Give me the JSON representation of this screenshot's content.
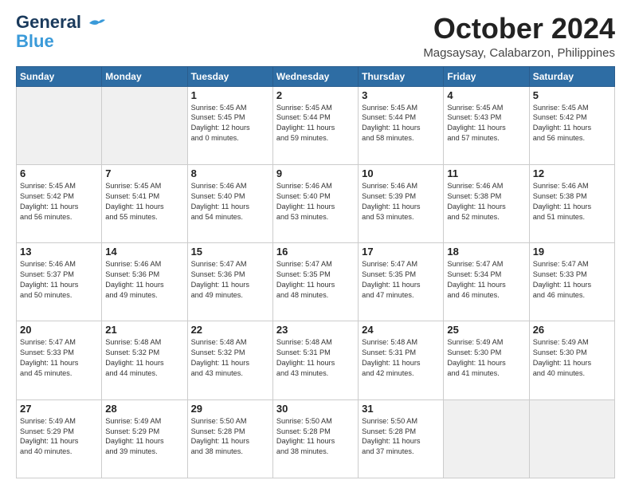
{
  "logo": {
    "line1": "General",
    "line2": "Blue"
  },
  "header": {
    "month": "October 2024",
    "location": "Magsaysay, Calabarzon, Philippines"
  },
  "weekdays": [
    "Sunday",
    "Monday",
    "Tuesday",
    "Wednesday",
    "Thursday",
    "Friday",
    "Saturday"
  ],
  "weeks": [
    [
      {
        "day": "",
        "info": ""
      },
      {
        "day": "",
        "info": ""
      },
      {
        "day": "1",
        "info": "Sunrise: 5:45 AM\nSunset: 5:45 PM\nDaylight: 12 hours\nand 0 minutes."
      },
      {
        "day": "2",
        "info": "Sunrise: 5:45 AM\nSunset: 5:44 PM\nDaylight: 11 hours\nand 59 minutes."
      },
      {
        "day": "3",
        "info": "Sunrise: 5:45 AM\nSunset: 5:44 PM\nDaylight: 11 hours\nand 58 minutes."
      },
      {
        "day": "4",
        "info": "Sunrise: 5:45 AM\nSunset: 5:43 PM\nDaylight: 11 hours\nand 57 minutes."
      },
      {
        "day": "5",
        "info": "Sunrise: 5:45 AM\nSunset: 5:42 PM\nDaylight: 11 hours\nand 56 minutes."
      }
    ],
    [
      {
        "day": "6",
        "info": "Sunrise: 5:45 AM\nSunset: 5:42 PM\nDaylight: 11 hours\nand 56 minutes."
      },
      {
        "day": "7",
        "info": "Sunrise: 5:45 AM\nSunset: 5:41 PM\nDaylight: 11 hours\nand 55 minutes."
      },
      {
        "day": "8",
        "info": "Sunrise: 5:46 AM\nSunset: 5:40 PM\nDaylight: 11 hours\nand 54 minutes."
      },
      {
        "day": "9",
        "info": "Sunrise: 5:46 AM\nSunset: 5:40 PM\nDaylight: 11 hours\nand 53 minutes."
      },
      {
        "day": "10",
        "info": "Sunrise: 5:46 AM\nSunset: 5:39 PM\nDaylight: 11 hours\nand 53 minutes."
      },
      {
        "day": "11",
        "info": "Sunrise: 5:46 AM\nSunset: 5:38 PM\nDaylight: 11 hours\nand 52 minutes."
      },
      {
        "day": "12",
        "info": "Sunrise: 5:46 AM\nSunset: 5:38 PM\nDaylight: 11 hours\nand 51 minutes."
      }
    ],
    [
      {
        "day": "13",
        "info": "Sunrise: 5:46 AM\nSunset: 5:37 PM\nDaylight: 11 hours\nand 50 minutes."
      },
      {
        "day": "14",
        "info": "Sunrise: 5:46 AM\nSunset: 5:36 PM\nDaylight: 11 hours\nand 49 minutes."
      },
      {
        "day": "15",
        "info": "Sunrise: 5:47 AM\nSunset: 5:36 PM\nDaylight: 11 hours\nand 49 minutes."
      },
      {
        "day": "16",
        "info": "Sunrise: 5:47 AM\nSunset: 5:35 PM\nDaylight: 11 hours\nand 48 minutes."
      },
      {
        "day": "17",
        "info": "Sunrise: 5:47 AM\nSunset: 5:35 PM\nDaylight: 11 hours\nand 47 minutes."
      },
      {
        "day": "18",
        "info": "Sunrise: 5:47 AM\nSunset: 5:34 PM\nDaylight: 11 hours\nand 46 minutes."
      },
      {
        "day": "19",
        "info": "Sunrise: 5:47 AM\nSunset: 5:33 PM\nDaylight: 11 hours\nand 46 minutes."
      }
    ],
    [
      {
        "day": "20",
        "info": "Sunrise: 5:47 AM\nSunset: 5:33 PM\nDaylight: 11 hours\nand 45 minutes."
      },
      {
        "day": "21",
        "info": "Sunrise: 5:48 AM\nSunset: 5:32 PM\nDaylight: 11 hours\nand 44 minutes."
      },
      {
        "day": "22",
        "info": "Sunrise: 5:48 AM\nSunset: 5:32 PM\nDaylight: 11 hours\nand 43 minutes."
      },
      {
        "day": "23",
        "info": "Sunrise: 5:48 AM\nSunset: 5:31 PM\nDaylight: 11 hours\nand 43 minutes."
      },
      {
        "day": "24",
        "info": "Sunrise: 5:48 AM\nSunset: 5:31 PM\nDaylight: 11 hours\nand 42 minutes."
      },
      {
        "day": "25",
        "info": "Sunrise: 5:49 AM\nSunset: 5:30 PM\nDaylight: 11 hours\nand 41 minutes."
      },
      {
        "day": "26",
        "info": "Sunrise: 5:49 AM\nSunset: 5:30 PM\nDaylight: 11 hours\nand 40 minutes."
      }
    ],
    [
      {
        "day": "27",
        "info": "Sunrise: 5:49 AM\nSunset: 5:29 PM\nDaylight: 11 hours\nand 40 minutes."
      },
      {
        "day": "28",
        "info": "Sunrise: 5:49 AM\nSunset: 5:29 PM\nDaylight: 11 hours\nand 39 minutes."
      },
      {
        "day": "29",
        "info": "Sunrise: 5:50 AM\nSunset: 5:28 PM\nDaylight: 11 hours\nand 38 minutes."
      },
      {
        "day": "30",
        "info": "Sunrise: 5:50 AM\nSunset: 5:28 PM\nDaylight: 11 hours\nand 38 minutes."
      },
      {
        "day": "31",
        "info": "Sunrise: 5:50 AM\nSunset: 5:28 PM\nDaylight: 11 hours\nand 37 minutes."
      },
      {
        "day": "",
        "info": ""
      },
      {
        "day": "",
        "info": ""
      }
    ]
  ]
}
